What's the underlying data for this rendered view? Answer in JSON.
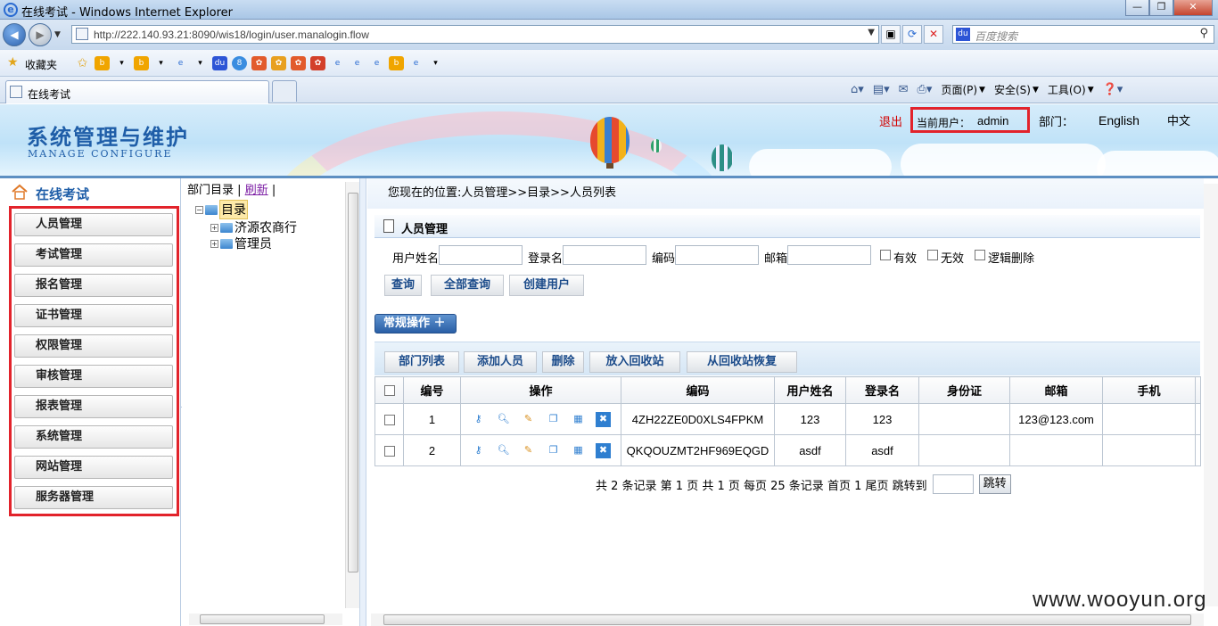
{
  "window": {
    "title": "在线考试 - Windows Internet Explorer",
    "url": "http://222.140.93.21:8090/wis18/login/user.manalogin.flow",
    "search_placeholder": "百度搜索",
    "favorites_label": "收藏夹",
    "tab_label": "在线考试",
    "cmd_page": "页面(P)",
    "cmd_safety": "安全(S)",
    "cmd_tools": "工具(O)"
  },
  "header": {
    "title": "系统管理与维护",
    "subtitle": "MANAGE CONFIGURE",
    "logout": "退出",
    "current_user_label": "当前用户：",
    "current_user": "admin",
    "dept_label": "部门：",
    "lang_en": "English",
    "lang_zh": "中文"
  },
  "sidebar": {
    "heading": "在线考试",
    "items": [
      {
        "label": "人员管理"
      },
      {
        "label": "考试管理"
      },
      {
        "label": "报名管理"
      },
      {
        "label": "证书管理"
      },
      {
        "label": "权限管理"
      },
      {
        "label": "审核管理"
      },
      {
        "label": "报表管理"
      },
      {
        "label": "系统管理"
      },
      {
        "label": "网站管理"
      },
      {
        "label": "服务器管理"
      }
    ]
  },
  "tree": {
    "header_label": "部门目录",
    "refresh": "刷新",
    "root": "目录",
    "children": [
      "济源农商行",
      "管理员"
    ]
  },
  "main": {
    "breadcrumb": "您现在的位置:人员管理>>目录>>人员列表",
    "section_title": "人员管理",
    "filters": {
      "username_label": "用户姓名",
      "login_label": "登录名",
      "code_label": "编码",
      "email_label": "邮箱",
      "valid_label": "有效",
      "invalid_label": "无效",
      "logic_delete_label": "逻辑删除"
    },
    "buttons": {
      "query": "查询",
      "query_all": "全部查询",
      "create_user": "创建用户",
      "common_ops": "常规操作 ＋",
      "dept_list": "部门列表",
      "add_person": "添加人员",
      "delete": "删除",
      "to_recycle": "放入回收站",
      "restore": "从回收站恢复"
    },
    "table": {
      "headers": [
        "编号",
        "操作",
        "编码",
        "用户姓名",
        "登录名",
        "身份证",
        "邮箱",
        "手机"
      ],
      "rows": [
        {
          "no": "1",
          "code": "4ZH22ZE0D0XLS4FPKM",
          "name": "123",
          "login": "123",
          "id_card": "",
          "email": "123@123.com",
          "phone": ""
        },
        {
          "no": "2",
          "code": "QKQOUZMT2HF969EQGD",
          "name": "asdf",
          "login": "asdf",
          "id_card": "",
          "email": "",
          "phone": ""
        }
      ]
    },
    "pager": {
      "text": "共 2 条记录  第 1 页  共 1 页  每页 25 条记录   首页  1  尾页  跳转到",
      "jump_button": "跳转"
    }
  },
  "watermark": "www.wooyun.org"
}
